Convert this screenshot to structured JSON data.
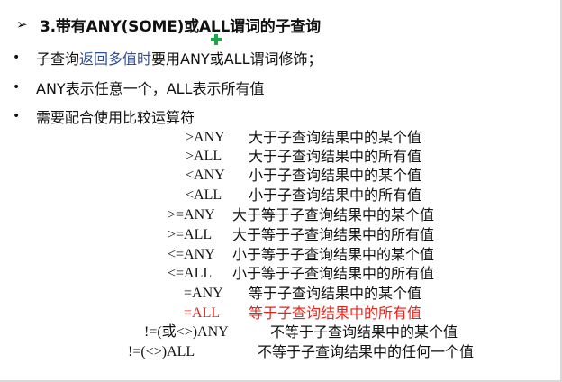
{
  "heading": {
    "bullet": "➢",
    "title": "3.带有ANY(SOME)或ALL谓词的子查询"
  },
  "bullets": [
    {
      "marker": "•",
      "parts": [
        {
          "text": "子查询",
          "style": "normal"
        },
        {
          "text": "返回多值时",
          "style": "blue"
        },
        {
          "text": "要用ANY或ALL谓词修饰；",
          "style": "normal"
        }
      ]
    },
    {
      "marker": "•",
      "parts": [
        {
          "text": "ANY表示任意一个，ALL表示所有值",
          "style": "normal"
        }
      ]
    },
    {
      "marker": "•",
      "parts": [
        {
          "text": "需要配合使用比较运算符",
          "style": "normal"
        }
      ]
    }
  ],
  "operators": [
    {
      "op": ">ANY",
      "desc": "大于子查询结果中的某个值",
      "highlight": false
    },
    {
      "op": ">ALL",
      "desc": "大于子查询结果中的所有值",
      "highlight": false
    },
    {
      "op": "<ANY",
      "desc": "小于子查询结果中的某个值",
      "highlight": false
    },
    {
      "op": "<ALL",
      "desc": "小于子查询结果中的所有值",
      "highlight": false
    },
    {
      "op": ">=ANY",
      "desc": "大于等于子查询结果中的某个值",
      "highlight": false
    },
    {
      "op": ">=ALL",
      "desc": "大于等于子查询结果中的所有值",
      "highlight": false
    },
    {
      "op": "<=ANY",
      "desc": "小于等于子查询结果中的某个值",
      "highlight": false
    },
    {
      "op": "<=ALL",
      "desc": "小于等于子查询结果中的所有值",
      "highlight": false
    },
    {
      "op": "=ANY",
      "desc": "等于子查询结果中的某个值",
      "highlight": false
    },
    {
      "op": "=ALL",
      "desc": "等于子查询结果中的所有值",
      "highlight": true
    },
    {
      "op": "!=(或<>)ANY",
      "desc": "不等于子查询结果中的某个值",
      "highlight": false
    },
    {
      "op": "!=(<>)ALL",
      "desc": "不等于子查询结果中的任何一个值",
      "highlight": false
    }
  ],
  "colors": {
    "highlight": "#e8231a",
    "link_blue": "#2f4f9a",
    "cursor_green": "#1aa84a"
  }
}
